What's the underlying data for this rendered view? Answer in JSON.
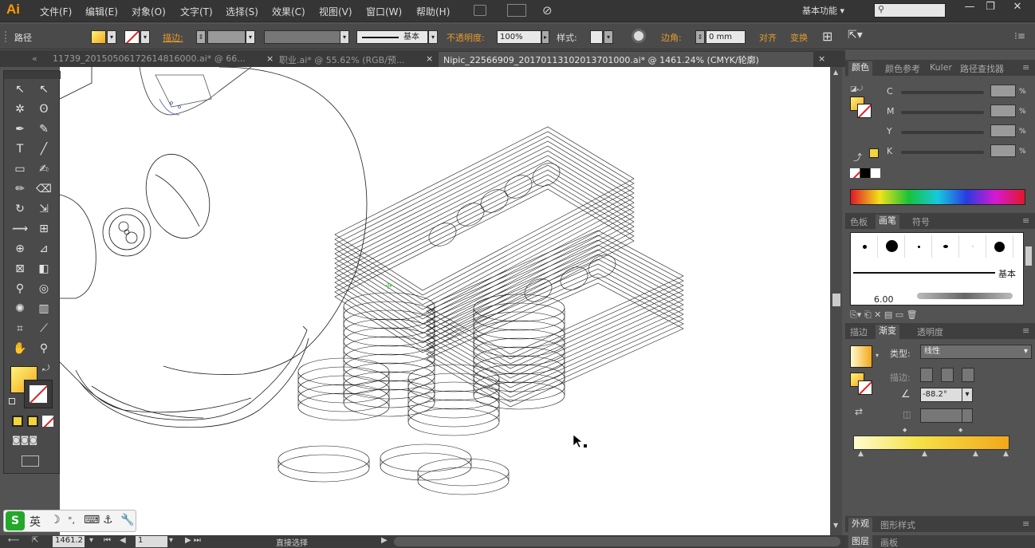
{
  "app": {
    "logo": "Ai",
    "workspace": "基本功能",
    "workspace_arrow": "▾"
  },
  "menu": [
    "文件(F)",
    "编辑(E)",
    "对象(O)",
    "文字(T)",
    "选择(S)",
    "效果(C)",
    "视图(V)",
    "窗口(W)",
    "帮助(H)"
  ],
  "window_controls": {
    "minimize": "—",
    "restore": "❐",
    "close": "✕"
  },
  "control_bar": {
    "selection": "路径",
    "stroke_label": "描边:",
    "brush_label": "基本",
    "opacity_label": "不透明度:",
    "opacity_value": "100%",
    "style_label": "样式:",
    "corner_label": "边角:",
    "corner_value": "0 mm",
    "align_label": "对齐",
    "transform_label": "变换"
  },
  "tabs": [
    {
      "label": "11739_20150506172614816000.ai* @ 66...",
      "active": false
    },
    {
      "label": "职业.ai* @ 55.62% (RGB/预...",
      "active": false
    },
    {
      "label": "Nipic_22566909_20170113102013701000.ai* @ 1461.24% (CMYK/轮廓)",
      "active": true
    }
  ],
  "tab_close": "×",
  "tab_overflow": "«",
  "tools": [
    {
      "name": "selection-tool-icon",
      "glyph": "↖"
    },
    {
      "name": "direct-selection-tool-icon",
      "glyph": "↖"
    },
    {
      "name": "magic-wand-tool-icon",
      "glyph": "✲"
    },
    {
      "name": "lasso-tool-icon",
      "glyph": "ʘ"
    },
    {
      "name": "pen-tool-icon",
      "glyph": "✒"
    },
    {
      "name": "curvature-tool-icon",
      "glyph": "✎"
    },
    {
      "name": "type-tool-icon",
      "glyph": "T"
    },
    {
      "name": "line-tool-icon",
      "glyph": "╱"
    },
    {
      "name": "rectangle-tool-icon",
      "glyph": "▭"
    },
    {
      "name": "paintbrush-tool-icon",
      "glyph": "✍"
    },
    {
      "name": "pencil-tool-icon",
      "glyph": "✏"
    },
    {
      "name": "eraser-tool-icon",
      "glyph": "⌫"
    },
    {
      "name": "rotate-tool-icon",
      "glyph": "↻"
    },
    {
      "name": "scale-tool-icon",
      "glyph": "⇲"
    },
    {
      "name": "width-tool-icon",
      "glyph": "⟿"
    },
    {
      "name": "free-transform-tool-icon",
      "glyph": "⊞"
    },
    {
      "name": "shape-builder-tool-icon",
      "glyph": "⊕"
    },
    {
      "name": "perspective-grid-tool-icon",
      "glyph": "⊿"
    },
    {
      "name": "mesh-tool-icon",
      "glyph": "⊠"
    },
    {
      "name": "gradient-tool-icon",
      "glyph": "◧"
    },
    {
      "name": "eyedropper-tool-icon",
      "glyph": "⚲"
    },
    {
      "name": "blend-tool-icon",
      "glyph": "◎"
    },
    {
      "name": "symbol-sprayer-tool-icon",
      "glyph": "✺"
    },
    {
      "name": "column-graph-tool-icon",
      "glyph": "▥"
    },
    {
      "name": "artboard-tool-icon",
      "glyph": "⌗"
    },
    {
      "name": "slice-tool-icon",
      "glyph": "⟋"
    },
    {
      "name": "hand-tool-icon",
      "glyph": "✋"
    },
    {
      "name": "zoom-tool-icon",
      "glyph": "⚲"
    }
  ],
  "ime_bar": {
    "logo": "S",
    "lang": "英",
    "items": [
      "☽",
      "°,",
      "⌨",
      "⚓",
      "🔧"
    ]
  },
  "status": {
    "zoom": "1461.2",
    "zoom_arrow": "▾",
    "page": "1",
    "mode": "直接选择"
  },
  "panels": {
    "color_tabs": [
      "颜色",
      "颜色参考",
      "Kuler",
      "路径查找器"
    ],
    "cmyk": [
      "C",
      "M",
      "Y",
      "K"
    ],
    "pct": "%",
    "brush_tabs": [
      "色板",
      "画笔",
      "符号"
    ],
    "brush_basic": "基本",
    "brush_size": "6.00",
    "gradient_tabs": [
      "描边",
      "渐变",
      "透明度"
    ],
    "type_label": "类型:",
    "type_value": "线性",
    "stroke_label": "描边:",
    "angle_value": "-88.2°",
    "bottom_tabs": [
      "外观",
      "图形样式"
    ],
    "bottom_tabs2": [
      "图层",
      "画板"
    ]
  },
  "colors": {
    "fill_light": "#fff37a",
    "fill_dark": "#f2a71b",
    "accent": "#e59b2b"
  }
}
